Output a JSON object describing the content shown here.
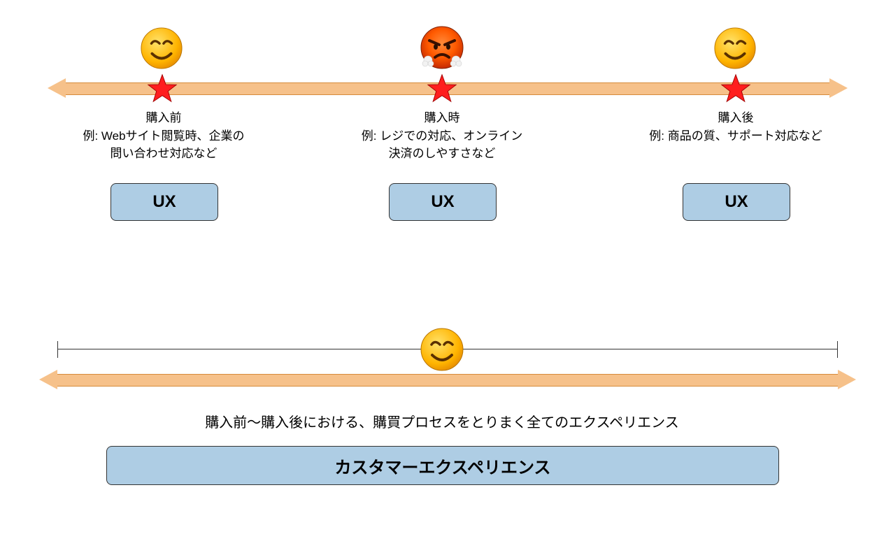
{
  "stages": [
    {
      "title": "購入前",
      "example": "例: Webサイト閲覧時、企業の\n問い合わせ対応など",
      "box": "UX",
      "face": "happy"
    },
    {
      "title": "購入時",
      "example": "例: レジでの対応、オンライン\n決済のしやすさなど",
      "box": "UX",
      "face": "angry"
    },
    {
      "title": "購入後",
      "example": "例: 商品の質、サポート対応など",
      "box": "UX",
      "face": "happy"
    }
  ],
  "bottom": {
    "face": "happy",
    "caption": "購入前〜購入後における、購買プロセスをとりまく全てのエクスペリエンス",
    "box": "カスタマーエクスペリエンス"
  },
  "colors": {
    "barFill": "#f6c18a",
    "barStroke": "#d68b3a",
    "box": "#aecde4",
    "star": "#ff1e1e"
  }
}
